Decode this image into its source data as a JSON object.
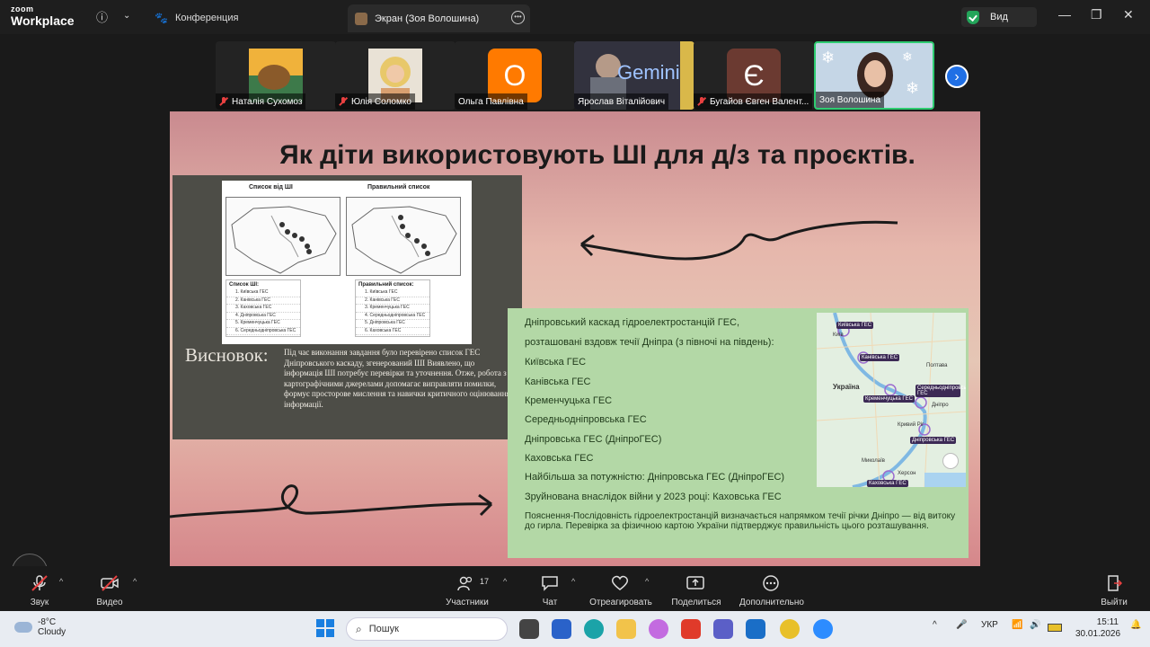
{
  "titlebar": {
    "logo_top": "zoom",
    "logo_bottom": "Workplace",
    "conf_tab": "Конференция",
    "screen_tab": "Экран (Зоя Волошина)",
    "view_label": "Вид",
    "minimize": "—",
    "maximize": "❐",
    "close": "✕"
  },
  "participants": [
    {
      "name": "Наталія Сухомоз",
      "muted": true,
      "avatar_color": "#e8a23a"
    },
    {
      "name": "Юлія Соломко",
      "muted": true,
      "avatar_color": "#e9dcc9"
    },
    {
      "name": "Ольга Павлівна",
      "muted": false,
      "avatar_color": "#ff7a00",
      "initial": "О"
    },
    {
      "name": "Ярослав Віталійович",
      "muted": false,
      "avatar_color": "#2d2d3a",
      "video_text": "Gemini"
    },
    {
      "name": "Бугайов Євген Валент...",
      "muted": true,
      "avatar_color": "#6b3a31",
      "initial": "Є"
    },
    {
      "name": "Зоя Волошина",
      "muted": false,
      "avatar_color": "#b9cde0",
      "active": true
    }
  ],
  "slide": {
    "title": "Як діти використовують ШІ для д/з та проєктів.",
    "map_left_title": "Список від ШІ",
    "map_right_title": "Правильний список",
    "ai_list": {
      "heading": "Список ШІ:",
      "items": [
        "1. Київська ГЕС",
        "2. Канівська ГЕС",
        "3. Каховська ГЕС",
        "4. Дніпровська ГЕС",
        "5. Кременчуцька ГЕС",
        "6. Середньодніпровська ГЕС"
      ]
    },
    "correct_list": {
      "heading": "Правильний список:",
      "items": [
        "1. Київська ГЕС",
        "2. Канівська ГЕС",
        "3. Кременчуцька ГЕС",
        "4. Середньодніпровська ГЕС",
        "5. Дніпровська ГЕС",
        "6. Каховська ГЕС"
      ]
    },
    "conclusion_heading": "Висновок:",
    "conclusion_text": "Під час виконання завдання було перевірено список ГЕС Дніпровського каскаду, згенерований ШІ Виявлено, що інформація ШІ потребує перевірки та уточнення. Отже, робота з картографічними джерелами допомагає виправляти помилки, формує просторове мислення та навички критичного оцінювання інформації.",
    "green": {
      "line1": "Дніпровський каскад гідроелектростанцій ГЕС,",
      "line2": "розташовані вздовж течії Дніпра (з півночі на південь):",
      "stations": [
        "Київська ГЕС",
        "Канівська ГЕС",
        "Кременчуцька ГЕС",
        "Середньодніпровська ГЕС",
        "Дніпровська ГЕС (ДніпроГЕС)",
        "Каховська ГЕС"
      ],
      "largest": "Найбільша за потужністю: Дніпровська ГЕС (ДніпроГЕС)",
      "destroyed": "Зруйнована внаслідок війни у 2023 році: Каховська ГЕС",
      "note": "Пояснення-Послідовність гідроелектростанцій визначається напрямком течії   річки Дніпро — від витоку до гирла. Перевірка за фізичною картою України підтверджує правильність цього розташування."
    },
    "gmap": {
      "labels": [
        "Київська ГЕС",
        "Канівська ГЕС",
        "Кременчуцька ГЕС",
        "Середньодніпровська ГЕС",
        "Дніпровська ГЕС",
        "Каховська ГЕС"
      ],
      "towns": [
        "Київ",
        "Полтава",
        "Україна",
        "Дніпро",
        "Кривий Ріг",
        "Миколаїв",
        "Херсон"
      ]
    }
  },
  "toolbar": {
    "audio": "Звук",
    "video": "Видео",
    "participants": "Участники",
    "participants_count": "17",
    "chat": "Чат",
    "react": "Отреагировать",
    "share": "Поделиться",
    "more": "Дополнительно",
    "leave": "Выйти"
  },
  "taskbar": {
    "temp": "-8°C",
    "weather": "Cloudy",
    "search_placeholder": "Пошук",
    "lang": "УКР",
    "time": "15:11",
    "date": "30.01.2026"
  },
  "colors": {
    "accent_blue": "#1f6fe5",
    "active_green": "#2ecc71",
    "mute_red": "#e84040",
    "slide_green": "#b3d8a6"
  }
}
